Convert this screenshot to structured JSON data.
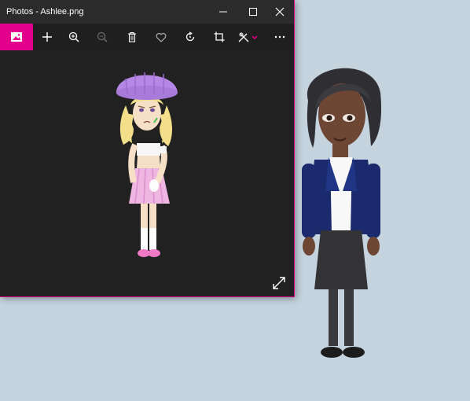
{
  "window": {
    "title": "Photos - Ashlee.png",
    "controls": [
      "minimize",
      "maximize",
      "close"
    ]
  },
  "toolbar": {
    "items": [
      {
        "name": "photos-home-icon",
        "active": true
      },
      {
        "name": "add-icon"
      },
      {
        "name": "zoom-in-icon"
      },
      {
        "name": "zoom-out-icon",
        "disabled": true
      },
      {
        "name": "delete-icon"
      },
      {
        "name": "favorite-icon"
      },
      {
        "name": "rotate-icon"
      },
      {
        "name": "crop-icon"
      },
      {
        "name": "edit-draw-icon"
      },
      {
        "name": "more-icon"
      }
    ]
  },
  "colors": {
    "accent": "#e3008c",
    "window_bg": "#212121",
    "titlebar_bg": "#2b2b2b",
    "desktop_bg": "#c4d3de"
  }
}
